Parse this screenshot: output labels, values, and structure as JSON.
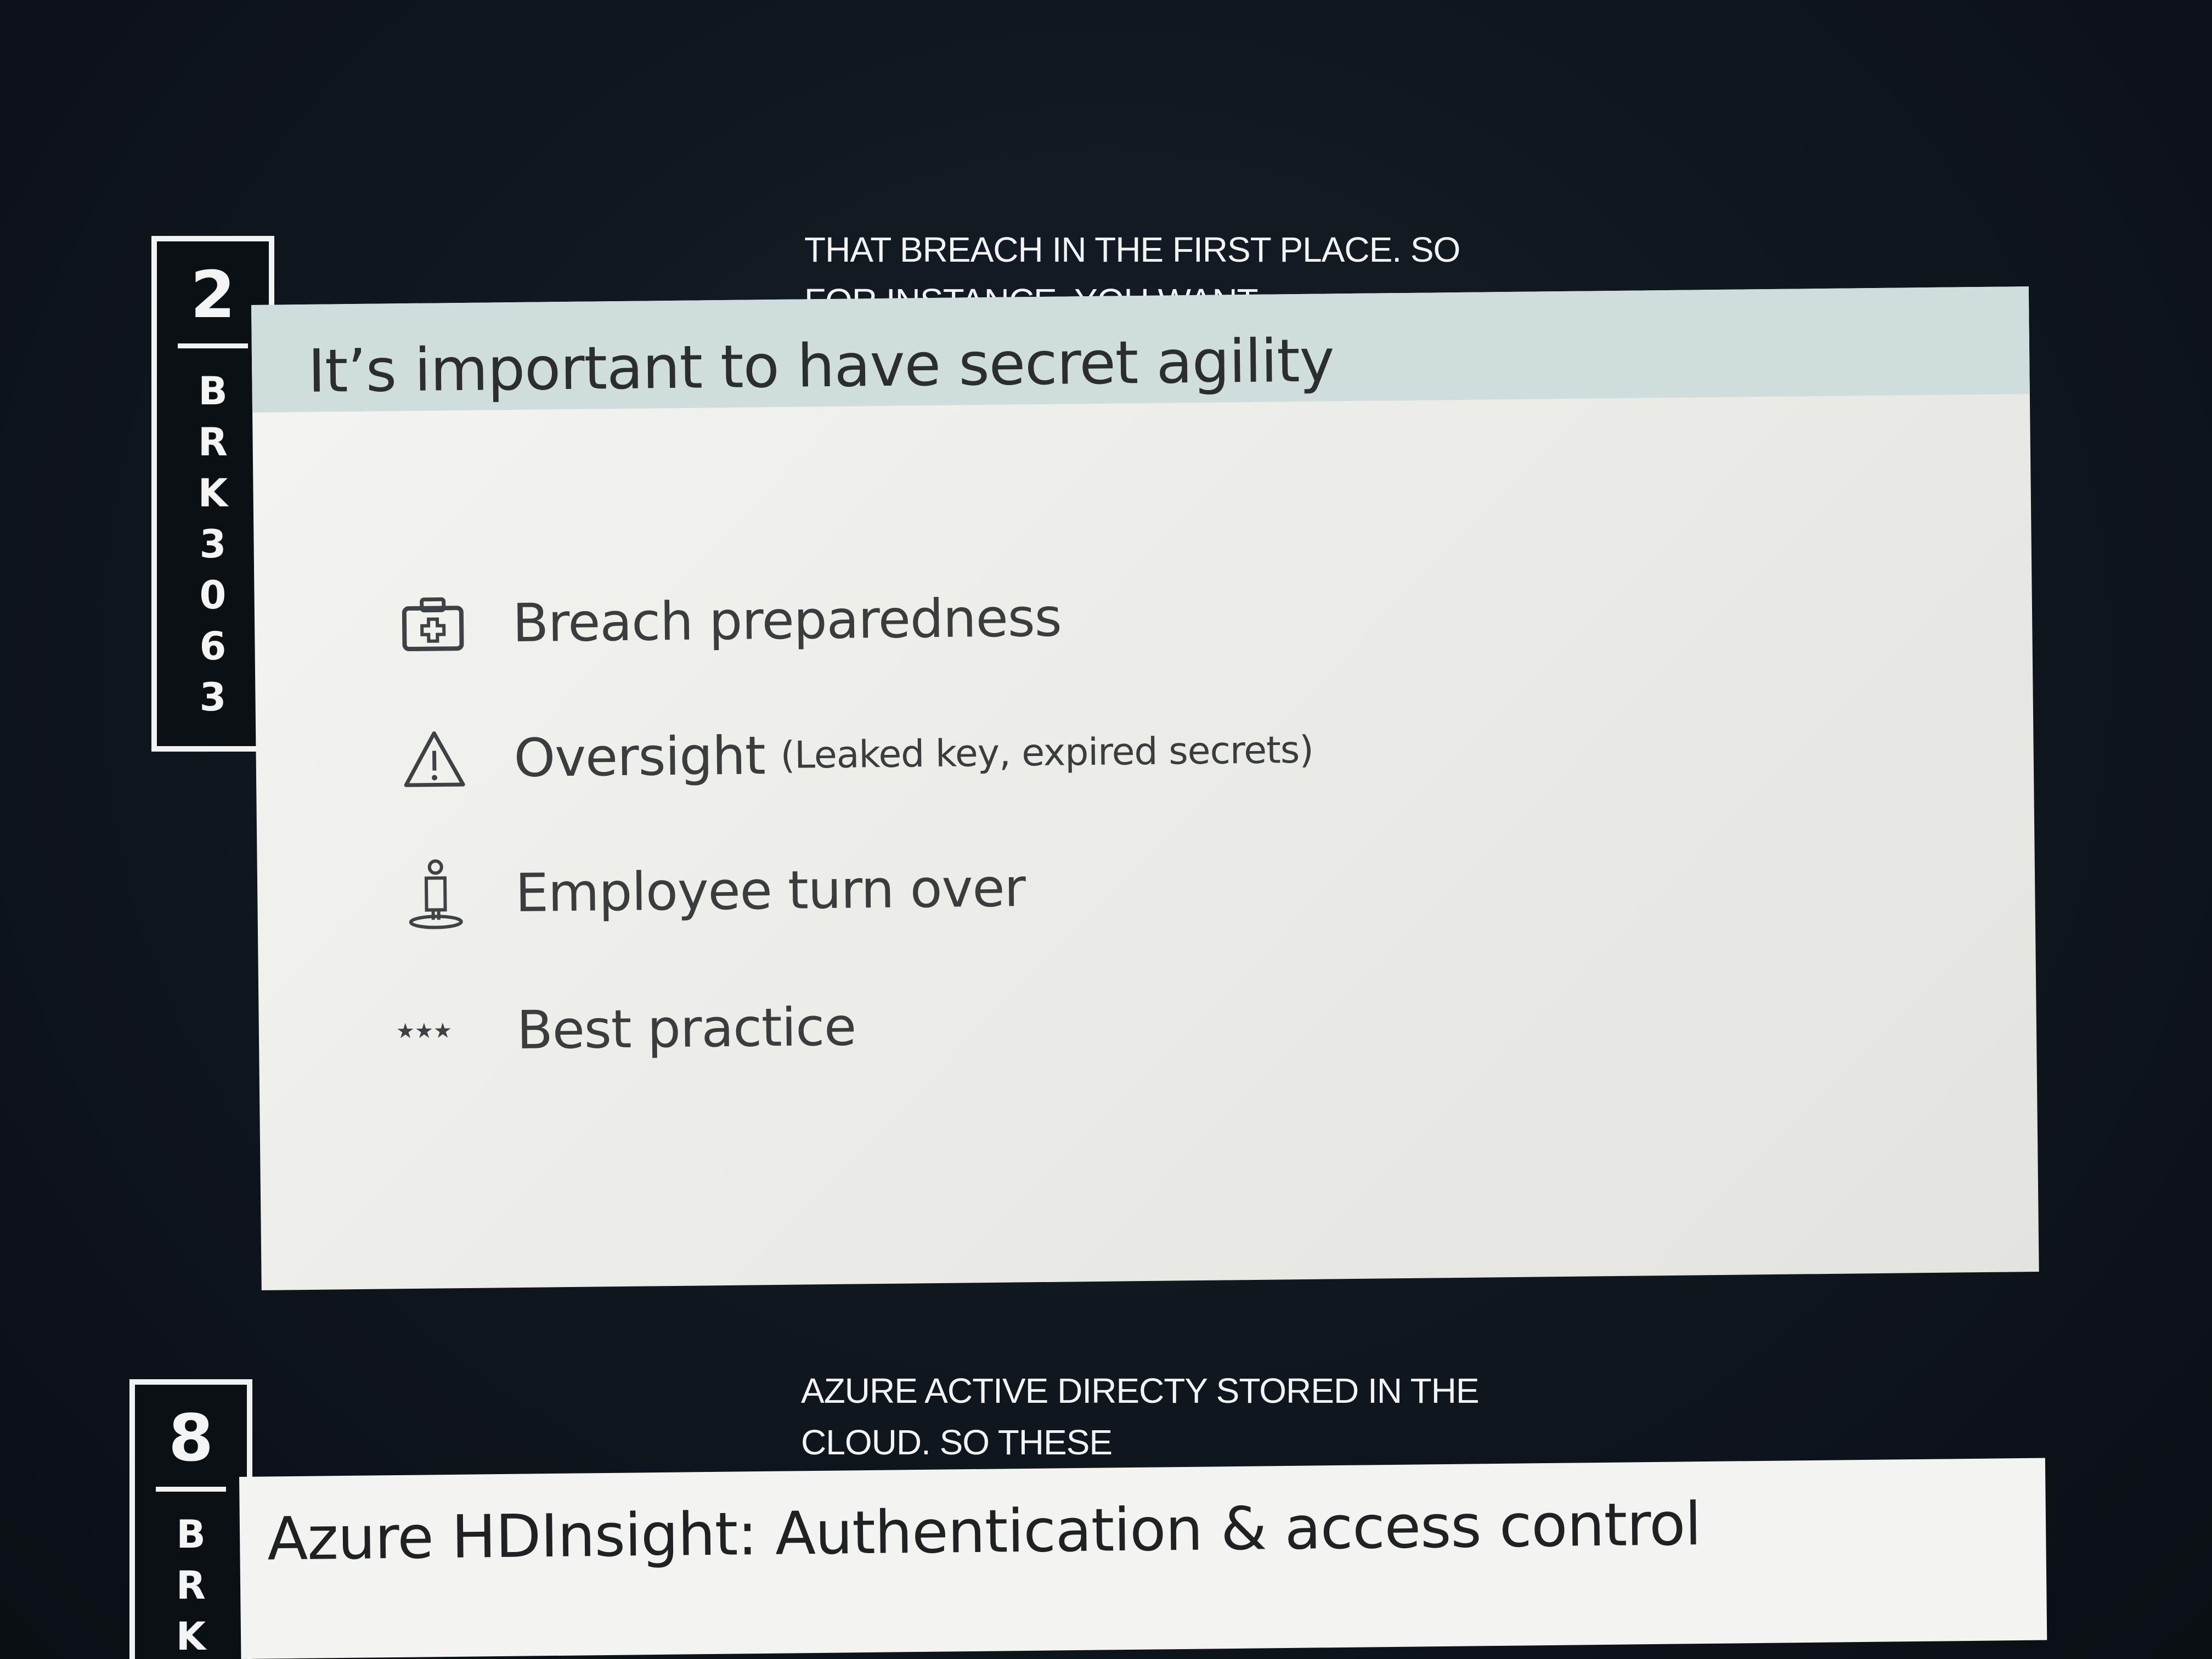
{
  "badge_top": {
    "number": "2",
    "letters": [
      "B",
      "R",
      "K",
      "3",
      "0",
      "6",
      "3"
    ]
  },
  "caption_top": {
    "line1": "THAT BREACH IN THE FIRST PLACE.  SO",
    "line2": "FOR INSTANCE,  YOU WANT"
  },
  "slide_top": {
    "title": "It’s important to have secret agility",
    "bullets": [
      {
        "icon": "first-aid-kit-icon",
        "text": "Breach preparedness",
        "sub": ""
      },
      {
        "icon": "warning-triangle-icon",
        "text": "Oversight",
        "sub": "(Leaked key, expired secrets)"
      },
      {
        "icon": "person-icon",
        "text": "Employee turn over",
        "sub": ""
      },
      {
        "icon": "stars-icon",
        "text": "Best practice",
        "sub": ""
      }
    ]
  },
  "badge_bottom": {
    "number": "8",
    "letters": [
      "B",
      "R",
      "K"
    ]
  },
  "caption_bottom": {
    "line1": "AZURE ACTIVE  DIRECTY STORED IN THE",
    "line2": "CLOUD.  SO THESE"
  },
  "slide_bottom": {
    "title": "Azure HDInsight: Authentication & access control"
  },
  "colors": {
    "screen_background": "#0e1419",
    "slide_background": "#ececE9",
    "slide_header": "#cfdedd",
    "caption_text": "#f3f3f3",
    "body_text": "#3a3c3e"
  }
}
